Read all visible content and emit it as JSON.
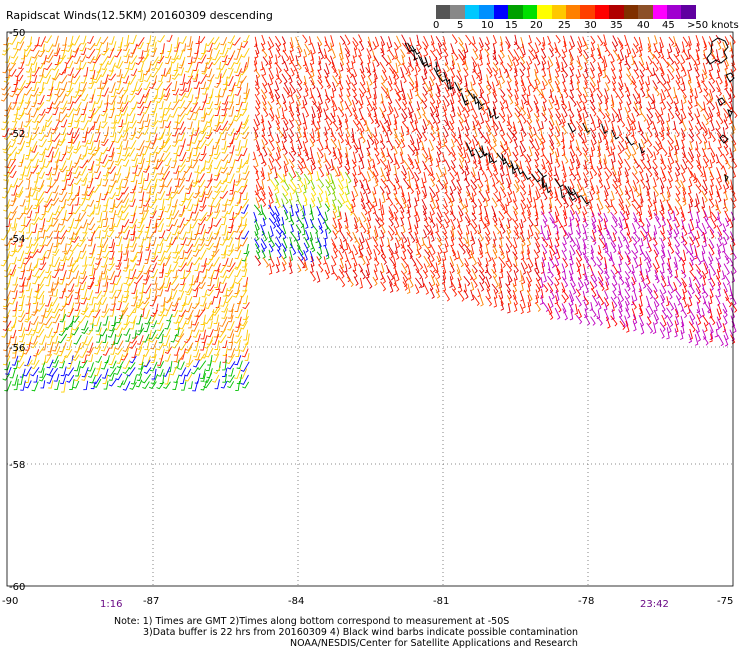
{
  "title": "Rapidscat Winds(12.5KM) 20160309 descending",
  "legend": {
    "colors": [
      "#555555",
      "#888888",
      "#00c8ff",
      "#0090ff",
      "#0000ff",
      "#00a000",
      "#00e000",
      "#ffff00",
      "#ffc800",
      "#ff8000",
      "#ff4000",
      "#ff0000",
      "#b00000",
      "#803000",
      "#8c5028",
      "#ff00ff",
      "#a000d0",
      "#6000a0"
    ],
    "labels": [
      "0",
      "5",
      "10",
      "15",
      "20",
      "25",
      "30",
      "35",
      "40",
      "45",
      ">50 knots"
    ]
  },
  "map": {
    "lat_labels": [
      "-50",
      "-52",
      "-54",
      "-56",
      "-58",
      "-60"
    ],
    "lon_labels": [
      "-90",
      "-87",
      "-84",
      "-81",
      "-78",
      "-75"
    ],
    "time_start": "1:16",
    "time_end": "23:42",
    "coastline": "coastline"
  },
  "notes": {
    "line1": "Note: 1) Times are GMT 2)Times along bottom correspond to measurement at -50S",
    "line2": "3)Data buffer is 22 hrs from 20160309 4) Black wind barbs indicate possible contamination",
    "line3": "NOAA/NESDIS/Center for Satellite Applications and Research"
  }
}
